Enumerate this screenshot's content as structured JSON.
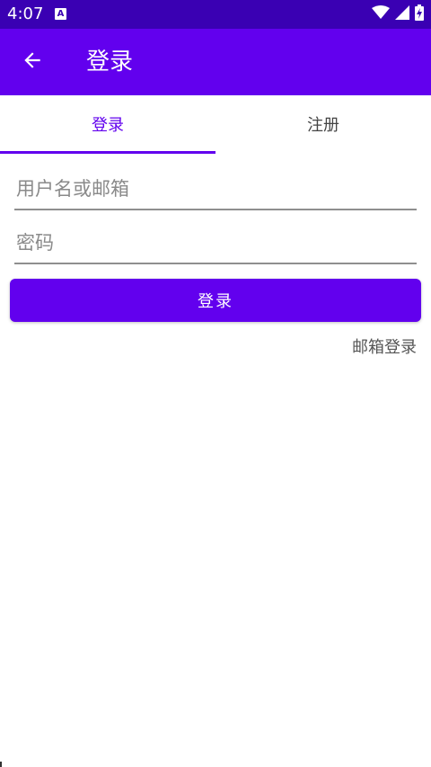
{
  "status_bar": {
    "time": "4:07",
    "notification_icon": "a-box-icon",
    "icons": [
      "wifi-icon",
      "signal-icon",
      "battery-charging-icon"
    ],
    "background": "#3a00b3"
  },
  "app_bar": {
    "title": "登录",
    "back_icon": "arrow-left-icon",
    "background": "#6200ee"
  },
  "tabs": {
    "items": [
      {
        "label": "登录",
        "selected": true
      },
      {
        "label": "注册",
        "selected": false
      }
    ],
    "accent": "#6200ee"
  },
  "form": {
    "username_placeholder": "用户名或邮箱",
    "username_value": "",
    "password_placeholder": "密码",
    "password_value": "",
    "submit_label": "登录",
    "email_login_link": "邮箱登录"
  }
}
